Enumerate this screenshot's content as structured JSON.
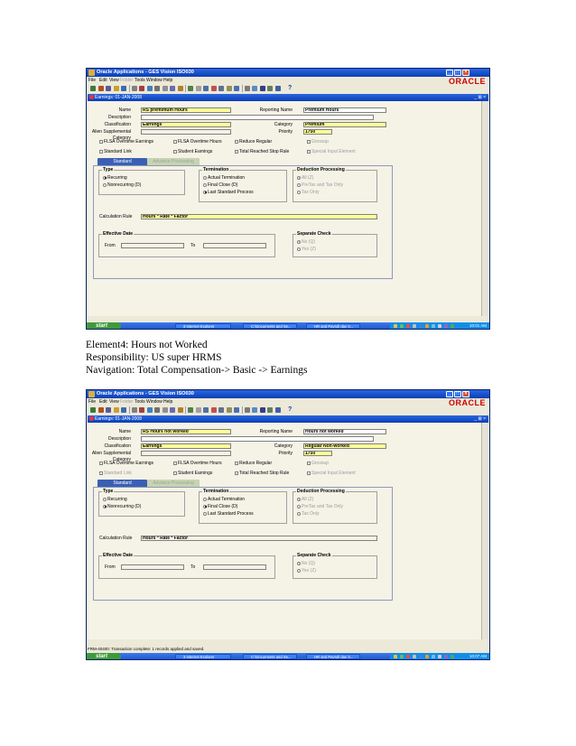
{
  "colors": {
    "title_bar": "#0a3fb5",
    "required_field": "#ffff99",
    "oracle_logo": "#d00000",
    "taskbar": "#1f55c8",
    "start_button": "#3f9a3a"
  },
  "captions": [
    "Element4: Hours not Worked",
    "Responsibility: US super HRMS",
    "Navigation: Total Compensation-> Basic -> Earnings"
  ],
  "shots": [
    {
      "window_title": "Oracle Applications - GES Vision ISO030",
      "logo": "ORACLE",
      "menu": [
        "File",
        "Edit",
        "View",
        "Folder",
        "Tools",
        "Window",
        "Help"
      ],
      "help_glyph": "?",
      "form_title": "Earnings: 01-JAN-2008",
      "inner_controls": "_ ⊠ ×",
      "labels": {
        "name": "Name",
        "description": "Description",
        "classification": "Classification",
        "alien": "Alien Supplemental",
        "category_left": "Category",
        "reporting_name": "Reporting Name",
        "category": "Category",
        "priority": "Priority",
        "calculation_rule": "Calculation Rule",
        "from": "From",
        "to": "To"
      },
      "values": {
        "name": "RS premimum Hours",
        "description": "",
        "classification": "Earnings",
        "reporting_name": "Premium Hours",
        "category": "Premium",
        "priority": "1750",
        "calculation_rule": "Hours * Rate * Factor",
        "from": "",
        "to": ""
      },
      "checkboxes": {
        "row1": [
          "FLSA Overtime Earnings",
          "FLSA Overtime Hours",
          "Reduce Regular",
          "Grossup"
        ],
        "row2": [
          "Standard Link",
          "Student Earnings",
          "Total Reached Stop Rule",
          "Special Input Element"
        ],
        "standard_link_enabled": true
      },
      "tabs": [
        "Standard",
        "Advance Processing"
      ],
      "type_group": {
        "title": "Type",
        "options": [
          "Recurring",
          "Nonrecurring (D)"
        ],
        "selected": "Recurring"
      },
      "termination_group": {
        "title": "Termination",
        "options": [
          "Actual Termination",
          "Final Close (D)",
          "Last Standard Process"
        ],
        "selected": "Last Standard Process"
      },
      "deduction_group": {
        "title": "Deduction Processing",
        "options": [
          "All (Z)",
          "PreTax and Tax Only",
          "Tax Only"
        ],
        "selected": "All (Z)"
      },
      "effective_group": {
        "title": "Effective Date"
      },
      "separate_group": {
        "title": "Separate Check",
        "options": [
          "No (Q)",
          "Yes (Z)"
        ],
        "selected": "No (Q)"
      },
      "status_text": "",
      "taskbar": {
        "start": "start",
        "buttons": [
          "3 Internet Explorer",
          "C:\\Documents and Se...",
          "HR and Payroll day 3..."
        ],
        "clock": "10:01 AM"
      }
    },
    {
      "window_title": "Oracle Applications - GES Vision ISO030",
      "logo": "ORACLE",
      "menu": [
        "File",
        "Edit",
        "View",
        "Folder",
        "Tools",
        "Window",
        "Help"
      ],
      "help_glyph": "?",
      "form_title": "Earnings: 01-JAN-2008",
      "inner_controls": "_ ⊠ ×",
      "labels": {
        "name": "Name",
        "description": "Description",
        "classification": "Classification",
        "alien": "Alien Supplemental",
        "category_left": "Category",
        "reporting_name": "Reporting Name",
        "category": "Category",
        "priority": "Priority",
        "calculation_rule": "Calculation Rule",
        "from": "From",
        "to": "To"
      },
      "values": {
        "name": "RS Hours not worked",
        "description": "",
        "classification": "Earnings",
        "reporting_name": "Hours not worked",
        "category": "Regular Non-worked",
        "priority": "1750",
        "calculation_rule": "Hours * Rate * Factor",
        "from": "",
        "to": ""
      },
      "checkboxes": {
        "row1": [
          "FLSA Overtime Earnings",
          "FLSA Overtime Hours",
          "Reduce Regular",
          "Grossup"
        ],
        "row2": [
          "Standard Link",
          "Student Earnings",
          "Total Reached Stop Rule",
          "Special Input Element"
        ],
        "standard_link_enabled": false
      },
      "tabs": [
        "Standard",
        "Advance Processing"
      ],
      "type_group": {
        "title": "Type",
        "options": [
          "Recurring",
          "Nonrecurring (D)"
        ],
        "selected": "Nonrecurring (D)"
      },
      "termination_group": {
        "title": "Termination",
        "options": [
          "Actual Termination",
          "Final Close (D)",
          "Last Standard Process"
        ],
        "selected": "Final Close (D)"
      },
      "deduction_group": {
        "title": "Deduction Processing",
        "options": [
          "All (Z)",
          "PreTax and Tax Only",
          "Tax Only"
        ],
        "selected": "All (Z)"
      },
      "effective_group": {
        "title": "Effective Date"
      },
      "separate_group": {
        "title": "Separate Check",
        "options": [
          "No (Q)",
          "Yes (Z)"
        ],
        "selected": "No (Q)"
      },
      "status_text": "FRM-40400: Transaction complete: 1 records applied and saved.",
      "taskbar": {
        "start": "start",
        "buttons": [
          "3 Internet Explorer",
          "C:\\Documents and Se...",
          "HR and Payroll day 3..."
        ],
        "clock": "10:07 AM"
      }
    }
  ]
}
